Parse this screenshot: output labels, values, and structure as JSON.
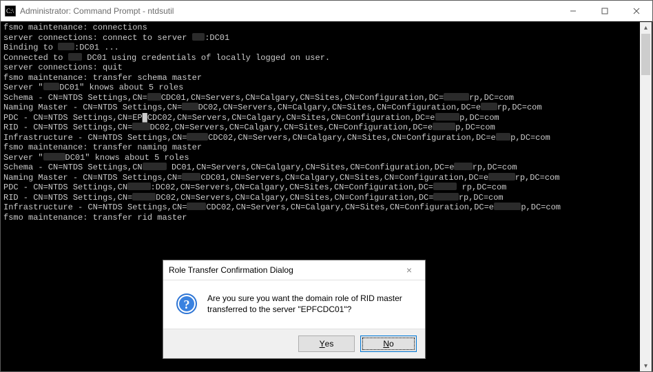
{
  "window": {
    "title": "Administrator: Command Prompt - ntdsutil"
  },
  "console_lines": [
    "fsmo maintenance: connections",
    "server connections: connect to server ███:DC01",
    "Binding to ███:DC01 ...",
    "Connected to ███ DC01 using credentials of locally logged on user.",
    "server connections: quit",
    "fsmo maintenance: transfer schema master",
    "Server \"███DC01\" knows about 5 roles",
    "Schema - CN=NTDS Settings,CN=███CDC01,CN=Servers,CN=Calgary,CN=Sites,CN=Configuration,DC=███rp,DC=com",
    "Naming Master - CN=NTDS Settings,CN=███DC02,CN=Servers,CN=Calgary,CN=Sites,CN=Configuration,DC=e███rp,DC=com",
    "PDC - CN=NTDS Settings,CN=EP█CDC02,CN=Servers,CN=Calgary,CN=Sites,CN=Configuration,DC=e███p,DC=com",
    "RID - CN=NTDS Settings,CN=███DC02,CN=Servers,CN=Calgary,CN=Sites,CN=Configuration,DC=e███p,DC=com",
    "Infrastructure - CN=NTDS Settings,CN=███CDC02,CN=Servers,CN=Calgary,CN=Sites,CN=Configuration,DC=e███p,DC=com",
    "fsmo maintenance: transfer naming master",
    "Server \"███DC01\" knows about 5 roles",
    "Schema - CN=NTDS Settings,CN███ DC01,CN=Servers,CN=Calgary,CN=Sites,CN=Configuration,DC=e███rp,DC=com",
    "Naming Master - CN=NTDS Settings,CN=███CDC01,CN=Servers,CN=Calgary,CN=Sites,CN=Configuration,DC=e███rp,DC=com",
    "PDC - CN=NTDS Settings,CN███:DC02,CN=Servers,CN=Calgary,CN=Sites,CN=Configuration,DC=███ rp,DC=com",
    "RID - CN=NTDS Settings,CN=███DC02,CN=Servers,CN=Calgary,CN=Sites,CN=Configuration,DC=███rp,DC=com",
    "Infrastructure - CN=NTDS Settings,CN=███CDC02,CN=Servers,CN=Calgary,CN=Sites,CN=Configuration,DC=e███p,DC=com",
    "fsmo maintenance: transfer rid master"
  ],
  "dialog": {
    "title": "Role Transfer Confirmation Dialog",
    "message_line1": "Are you sure you want the domain role of RID master",
    "message_line2": "transferred to the server \"EPFCDC01\"?",
    "yes": "Yes",
    "no": "No"
  }
}
